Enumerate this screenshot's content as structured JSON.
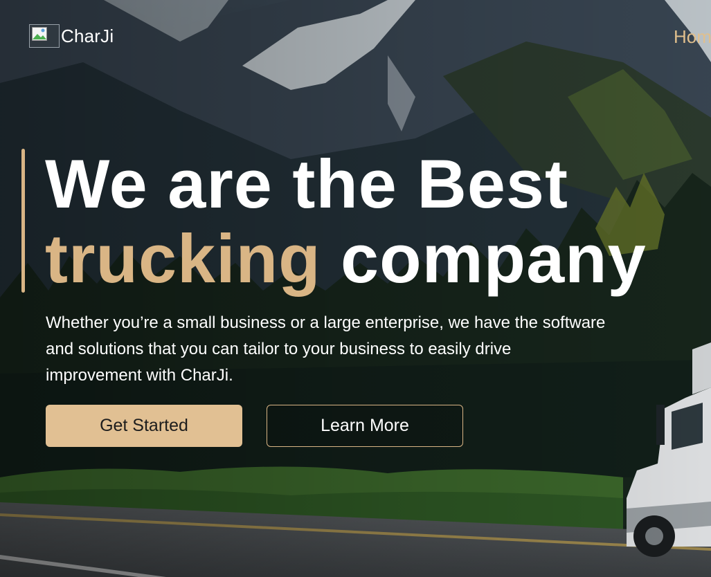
{
  "header": {
    "logo_image_icon": "broken-image-icon",
    "brand": "CharJi",
    "nav_link": "Hom"
  },
  "hero": {
    "title_line1": "We are the Best",
    "title_highlight": "trucking",
    "title_rest": " company",
    "description_line1": "Whether you’re a small business or a large enterprise, we have the software",
    "description_line2": "and solutions that you can tailor to your business to easily drive",
    "description_line3": "improvement with CharJi.",
    "primary_button": "Get Started",
    "secondary_button": "Learn More"
  },
  "colors": {
    "accent": "#d9b585",
    "button_fill": "#e1c093",
    "text": "#ffffff"
  }
}
